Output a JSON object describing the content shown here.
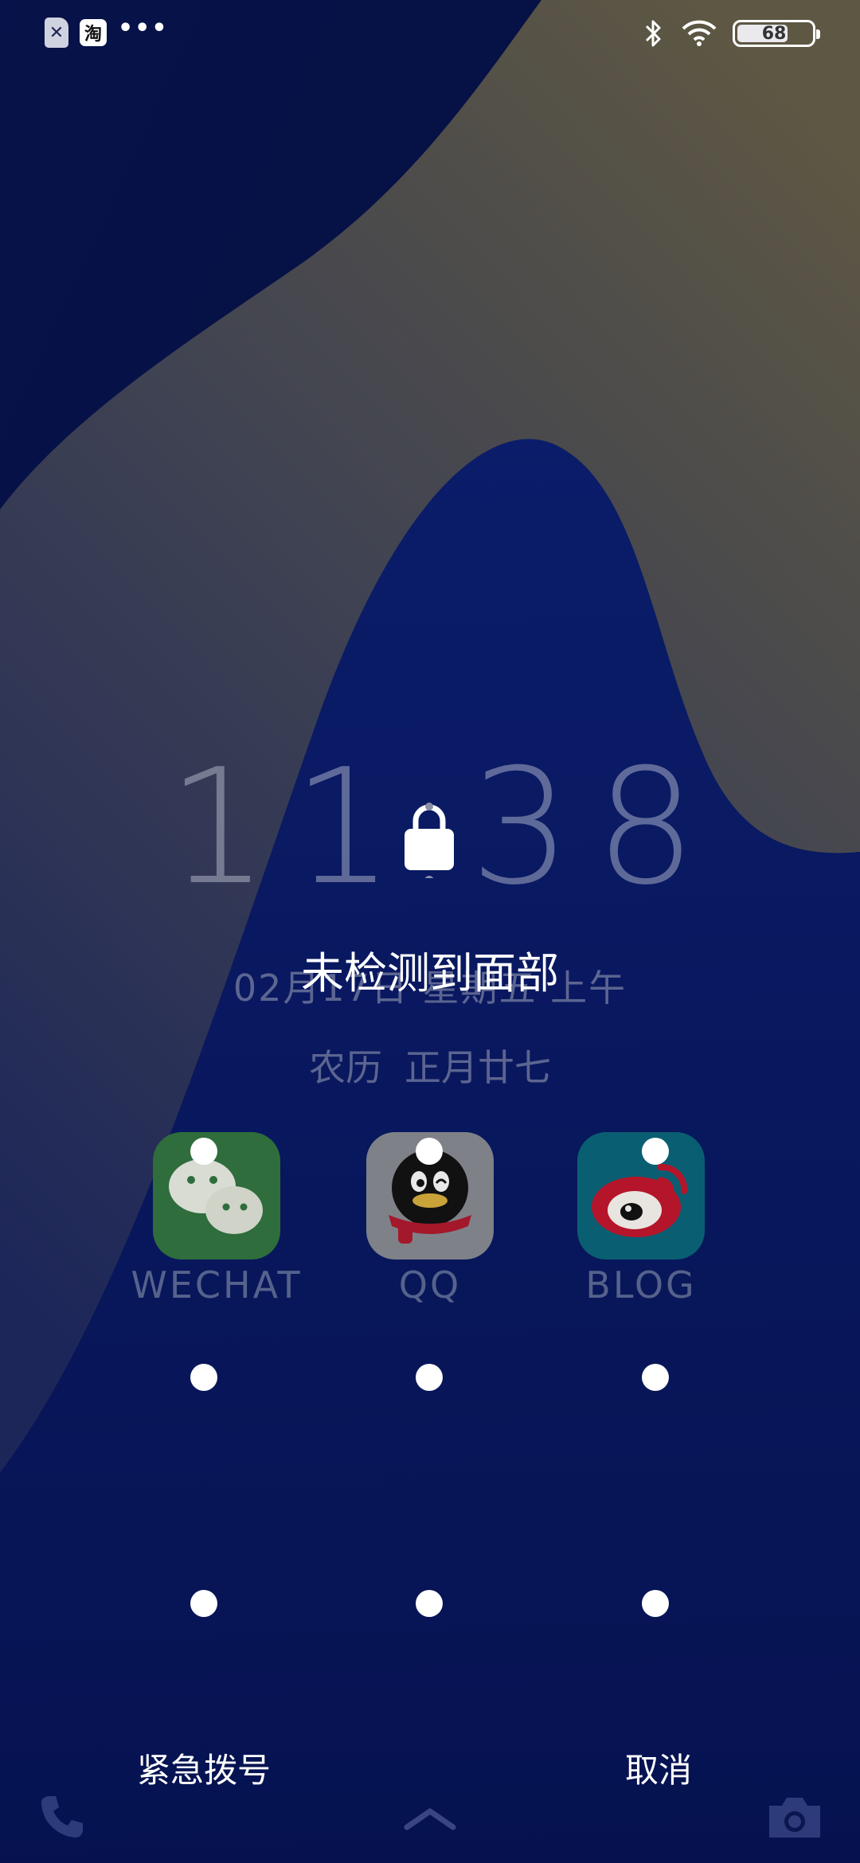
{
  "colors": {
    "wallpaper_base": "#0a1a5a",
    "wave_highlight": "#c9b55a",
    "wechat_tile": "#2f6d3c",
    "qq_tile": "#7f8189",
    "blog_tile": "#0a5e72"
  },
  "status_bar": {
    "left_icons": [
      "sim-card-x-icon",
      "taobao-icon",
      "more-dots-icon"
    ],
    "taobao_glyph": "淘",
    "more_text": "•••",
    "right_icons": [
      "bluetooth-icon",
      "wifi-icon",
      "battery-icon"
    ],
    "battery_level": "68",
    "battery_fraction": 0.68
  },
  "lockscreen": {
    "clock_hours": "11",
    "clock_minutes": "38",
    "face_message": "未检测到面部",
    "date": "02月17日 星期五 上午",
    "lunar_label": "农历",
    "lunar_date": "正月廿七"
  },
  "apps": [
    {
      "name": "WECHAT",
      "icon": "wechat-icon"
    },
    {
      "name": "QQ",
      "icon": "qq-penguin-icon"
    },
    {
      "name": "BLOG",
      "icon": "weibo-icon"
    }
  ],
  "pattern": {
    "rows": 3,
    "cols": 3
  },
  "bottom": {
    "emergency_label": "紧急拨号",
    "cancel_label": "取消",
    "icons": [
      "phone-icon",
      "chevron-up-icon",
      "camera-icon"
    ]
  }
}
